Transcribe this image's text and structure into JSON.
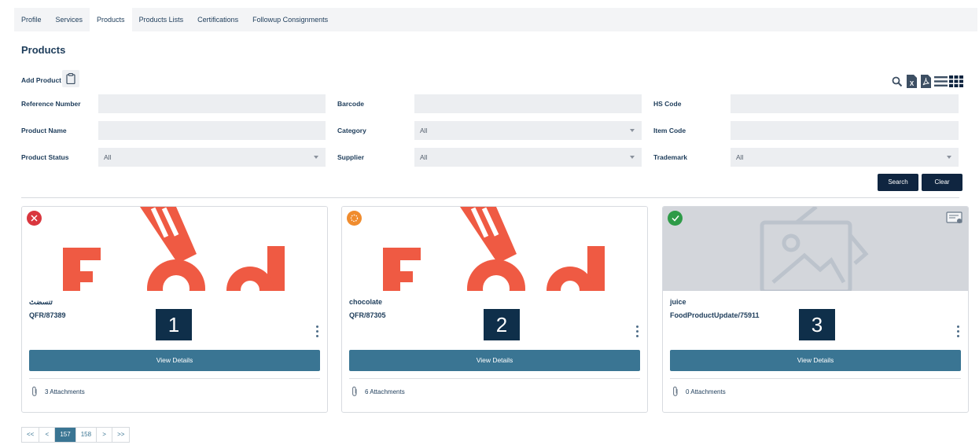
{
  "tabs": [
    "Profile",
    "Services",
    "Products",
    "Products Lists",
    "Certifications",
    "Followup Consignments"
  ],
  "active_tab": "Products",
  "page_title": "Products",
  "add_product_label": "Add Product",
  "toolbar_icons": [
    "search-icon",
    "excel-export-icon",
    "pdf-export-icon",
    "list-view-icon",
    "grid-view-icon"
  ],
  "filters": {
    "reference_number": {
      "label": "Reference Number",
      "value": ""
    },
    "barcode": {
      "label": "Barcode",
      "value": ""
    },
    "hs_code": {
      "label": "HS Code",
      "value": ""
    },
    "product_name": {
      "label": "Product Name",
      "value": ""
    },
    "category": {
      "label": "Category",
      "value": "All"
    },
    "item_code": {
      "label": "Item Code",
      "value": ""
    },
    "product_status": {
      "label": "Product Status",
      "value": "All"
    },
    "supplier": {
      "label": "Supplier",
      "value": "All"
    },
    "trademark": {
      "label": "Trademark",
      "value": "All"
    }
  },
  "buttons": {
    "search": "Search",
    "clear": "Clear"
  },
  "cards": [
    {
      "name": "تنسضث",
      "code": "QFR/87389",
      "status": "rejected",
      "status_color": "#d9363e",
      "image": "food-logo",
      "view": "View Details",
      "attachments": "3 Attachments",
      "number": "1"
    },
    {
      "name": "chocolate",
      "code": "QFR/87305",
      "status": "pending",
      "status_color": "#f08c2e",
      "image": "food-logo",
      "view": "View Details",
      "attachments": "6 Attachments",
      "number": "2"
    },
    {
      "name": "juice",
      "code": "FoodProductUpdate/75911",
      "status": "approved",
      "status_color": "#2e9b48",
      "image": "placeholder",
      "view": "View Details",
      "attachments": "0 Attachments",
      "number": "3"
    }
  ],
  "pagination": [
    "<<",
    "<",
    "157",
    "158",
    ">",
    ">>"
  ],
  "pagination_active": "157",
  "colors": {
    "primary": "#3a7593",
    "dark": "#0f2540",
    "food_red": "#ef5a43"
  }
}
